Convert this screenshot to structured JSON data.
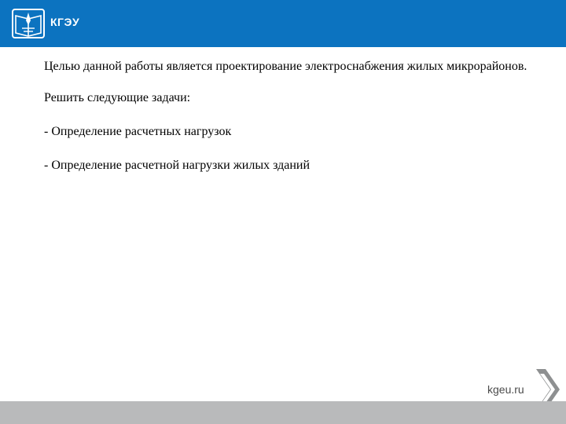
{
  "header": {
    "org_name": "КГЭУ",
    "logo_icon": "university-book-logo-icon",
    "brand_color": "#0c73c0"
  },
  "content": {
    "paragraph": "Целью данной работы является проектирование электроснабжения жилых микрорайонов.",
    "tasks_intro": "Решить следующие задачи:",
    "tasks": [
      "-  Определение расчетных нагрузок",
      "- Определение расчетной нагрузки жилых зданий"
    ]
  },
  "footer": {
    "url": "kgeu.ru",
    "nav_icon": "chevron-right-icon",
    "band_color": "#b9babb"
  }
}
